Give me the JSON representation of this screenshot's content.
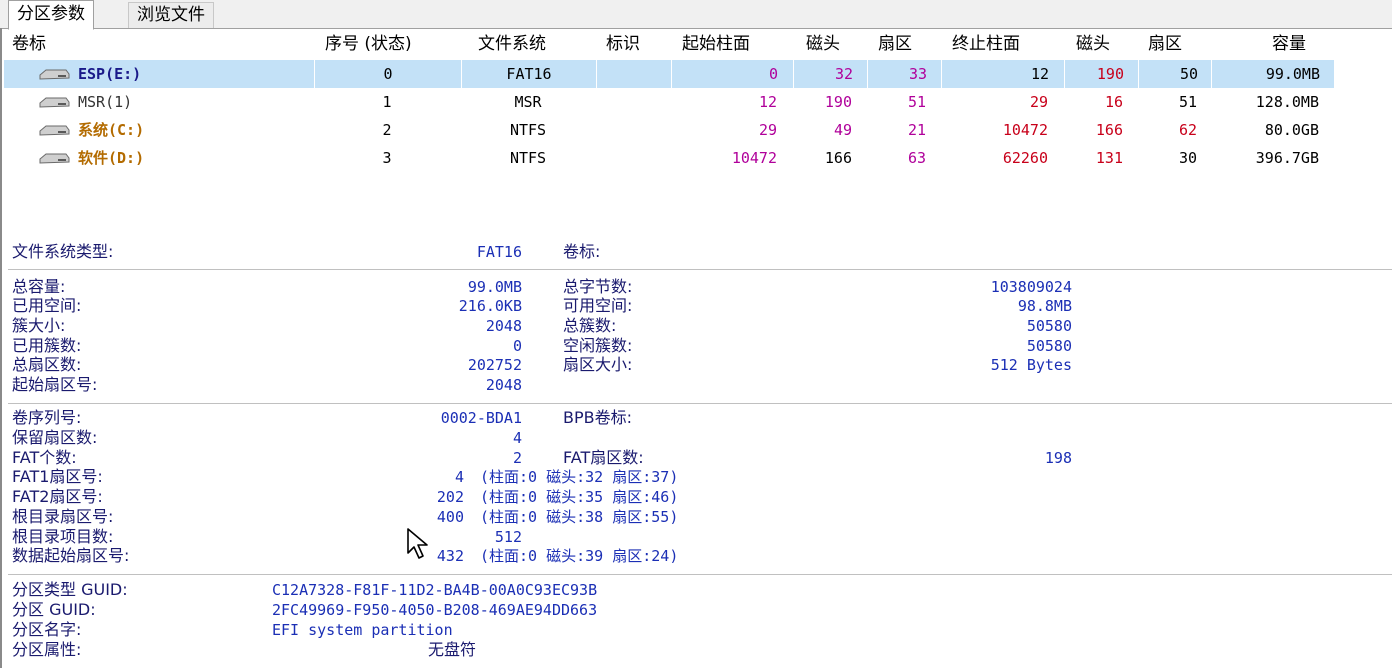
{
  "tabs": [
    "分区参数",
    "浏览文件"
  ],
  "columns": [
    "卷标",
    "序号 (状态)",
    "文件系统",
    "标识",
    "起始柱面",
    "磁头",
    "扇区",
    "终止柱面",
    "磁头",
    "扇区",
    "容量"
  ],
  "partitions": [
    {
      "label": "ESP(E:)",
      "index": "0",
      "fs": "FAT16",
      "flag": "",
      "start_cyl": "0",
      "start_head": "32",
      "start_sector": "33",
      "end_cyl": "12",
      "end_head": "190",
      "end_sector": "50",
      "capacity": "99.0MB"
    },
    {
      "label": "MSR(1)",
      "index": "1",
      "fs": "MSR",
      "flag": "",
      "start_cyl": "12",
      "start_head": "190",
      "start_sector": "51",
      "end_cyl": "29",
      "end_head": "16",
      "end_sector": "51",
      "capacity": "128.0MB"
    },
    {
      "label": "系统(C:)",
      "index": "2",
      "fs": "NTFS",
      "flag": "",
      "start_cyl": "29",
      "start_head": "49",
      "start_sector": "21",
      "end_cyl": "10472",
      "end_head": "166",
      "end_sector": "62",
      "capacity": "80.0GB"
    },
    {
      "label": "软件(D:)",
      "index": "3",
      "fs": "NTFS",
      "flag": "",
      "start_cyl": "10472",
      "start_head": "166",
      "start_sector": "63",
      "end_cyl": "62260",
      "end_head": "131",
      "end_sector": "30",
      "capacity": "396.7GB"
    }
  ],
  "fs_type": {
    "label": "文件系统类型:",
    "value": "FAT16",
    "vol_label": "卷标:"
  },
  "capacity": {
    "total_capacity_label": "总容量:",
    "total_capacity": "99.0MB",
    "total_bytes_label": "总字节数:",
    "total_bytes": "103809024",
    "used_space_label": "已用空间:",
    "used_space": "216.0KB",
    "free_space_label": "可用空间:",
    "free_space": "98.8MB",
    "cluster_size_label": "簇大小:",
    "cluster_size": "2048",
    "total_clusters_label": "总簇数:",
    "total_clusters": "50580",
    "used_clusters_label": "已用簇数:",
    "used_clusters": "0",
    "free_clusters_label": "空闲簇数:",
    "free_clusters": "50580",
    "total_sectors_label": "总扇区数:",
    "total_sectors": "202752",
    "sector_size_label": "扇区大小:",
    "sector_size": "512 Bytes",
    "start_sector_label": "起始扇区号:",
    "start_sector": "2048"
  },
  "fat": {
    "serial_label": "卷序列号:",
    "serial": "0002-BDA1",
    "bpb_label": "BPB卷标:",
    "reserved_label": "保留扇区数:",
    "reserved": "4",
    "fat_count_label": "FAT个数:",
    "fat_count": "2",
    "fat_sectors_label": "FAT扇区数:",
    "fat_sectors": "198",
    "fat1_label": "FAT1扇区号:",
    "fat1": "4",
    "fat1_chs": "(柱面:0 磁头:32 扇区:37)",
    "fat2_label": "FAT2扇区号:",
    "fat2": "202",
    "fat2_chs": "(柱面:0 磁头:35 扇区:46)",
    "root_label": "根目录扇区号:",
    "root": "400",
    "root_chs": "(柱面:0 磁头:38 扇区:55)",
    "root_entries_label": "根目录项目数:",
    "root_entries": "512",
    "data_start_label": "数据起始扇区号:",
    "data_start": "432",
    "data_start_chs": "(柱面:0 磁头:39 扇区:24)"
  },
  "guid": {
    "type_guid_label": "分区类型 GUID:",
    "type_guid": "C12A7328-F81F-11D2-BA4B-00A0C93EC93B",
    "part_guid_label": "分区 GUID:",
    "part_guid": "2FC49969-F950-4050-B208-469AE94DD663",
    "name_label": "分区名字:",
    "name": "EFI system partition",
    "attr_label": "分区属性:",
    "attr": "无盘符"
  },
  "colors": {
    "selected_row": "#c3e1f7",
    "values": "#1b2fb5",
    "magenta": "#b0009a",
    "red": "#c8001a",
    "brown": "#b36b00"
  }
}
